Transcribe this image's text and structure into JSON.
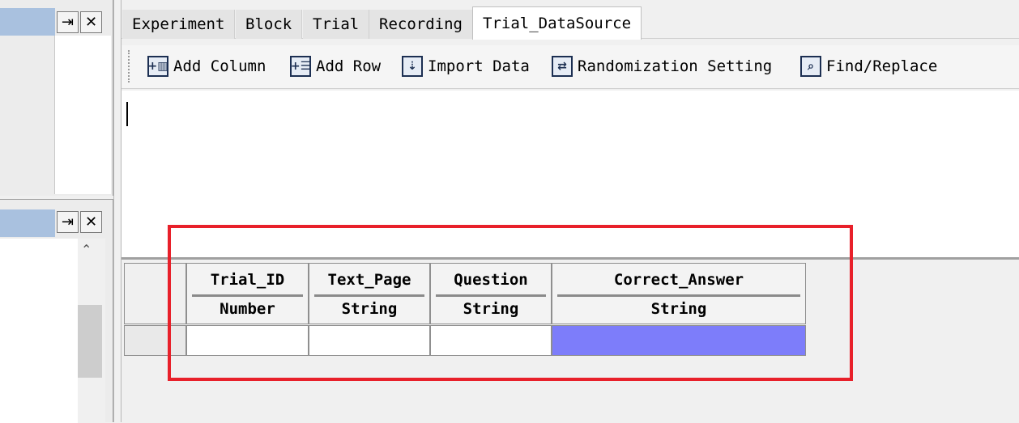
{
  "left_panes": {
    "top": {
      "pin_icon": "pin-icon",
      "close_icon": "close-icon"
    },
    "bottom": {
      "pin_icon": "pin-icon",
      "close_icon": "close-icon",
      "scroll_up_icon": "scroll-up-arrow"
    }
  },
  "tabs": [
    {
      "label": "Experiment",
      "active": false
    },
    {
      "label": "Block",
      "active": false
    },
    {
      "label": "Trial",
      "active": false
    },
    {
      "label": "Recording",
      "active": false
    },
    {
      "label": "Trial_DataSource",
      "active": true
    }
  ],
  "toolbar": {
    "add_column": {
      "label": "Add Column",
      "icon": "add-column-icon"
    },
    "add_row": {
      "label": "Add Row",
      "icon": "add-row-icon"
    },
    "import_data": {
      "label": "Import Data",
      "icon": "import-data-icon"
    },
    "randomization": {
      "label": "Randomization Setting",
      "icon": "randomization-icon"
    },
    "find_replace": {
      "label": "Find/Replace",
      "icon": "binoculars-icon"
    }
  },
  "grid": {
    "columns": [
      {
        "name": "Trial_ID",
        "type": "Number"
      },
      {
        "name": "Text_Page",
        "type": "String"
      },
      {
        "name": "Question",
        "type": "String"
      },
      {
        "name": "Correct_Answer",
        "type": "String"
      }
    ],
    "rows": [
      {
        "cells": [
          "",
          "",
          "",
          ""
        ],
        "selected_cell": 3
      }
    ]
  },
  "colors": {
    "selected_cell": "#7d7dfa",
    "highlight_box": "#e8202a",
    "pane_title": "#a9c1df"
  }
}
